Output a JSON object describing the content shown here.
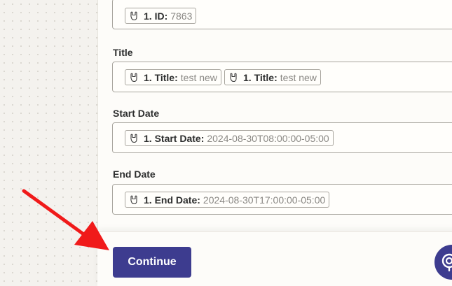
{
  "fields": [
    {
      "label": "",
      "pills": [
        {
          "key": "1. ID:",
          "value": "7863"
        }
      ]
    },
    {
      "label": "Title",
      "pills": [
        {
          "key": "1. Title:",
          "value": "test new"
        },
        {
          "key": "1. Title:",
          "value": "test new"
        }
      ]
    },
    {
      "label": "Start Date",
      "pills": [
        {
          "key": "1. Start Date:",
          "value": "2024-08-30T08:00:00-05:00"
        }
      ]
    },
    {
      "label": "End Date",
      "pills": [
        {
          "key": "1. End Date:",
          "value": "2024-08-30T17:00:00-05:00"
        }
      ]
    }
  ],
  "footer": {
    "continue_label": "Continue"
  },
  "icons": {
    "pill": "rock-hand-icon",
    "help": "help-support-icon"
  },
  "colors": {
    "primary": "#3d3c8f",
    "annotation_arrow": "#f01a1a"
  }
}
